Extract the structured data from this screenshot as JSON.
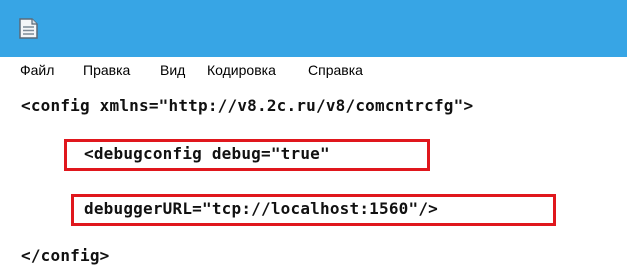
{
  "titlebar": {
    "icon": "notepad-icon",
    "color": "#37a5e5"
  },
  "menu": {
    "items": [
      {
        "label": "Файл"
      },
      {
        "label": "Правка"
      },
      {
        "label": "Вид"
      },
      {
        "label": "Кодировка"
      },
      {
        "label": "Справка"
      }
    ]
  },
  "editor": {
    "lines": [
      "<config xmlns=\"http://v8.2c.ru/v8/comcntrcfg\">",
      "<debugconfig debug=\"true\"",
      "debuggerURL=\"tcp://localhost:1560\"/>",
      "</config>"
    ],
    "highlight_color": "#e0171d"
  }
}
